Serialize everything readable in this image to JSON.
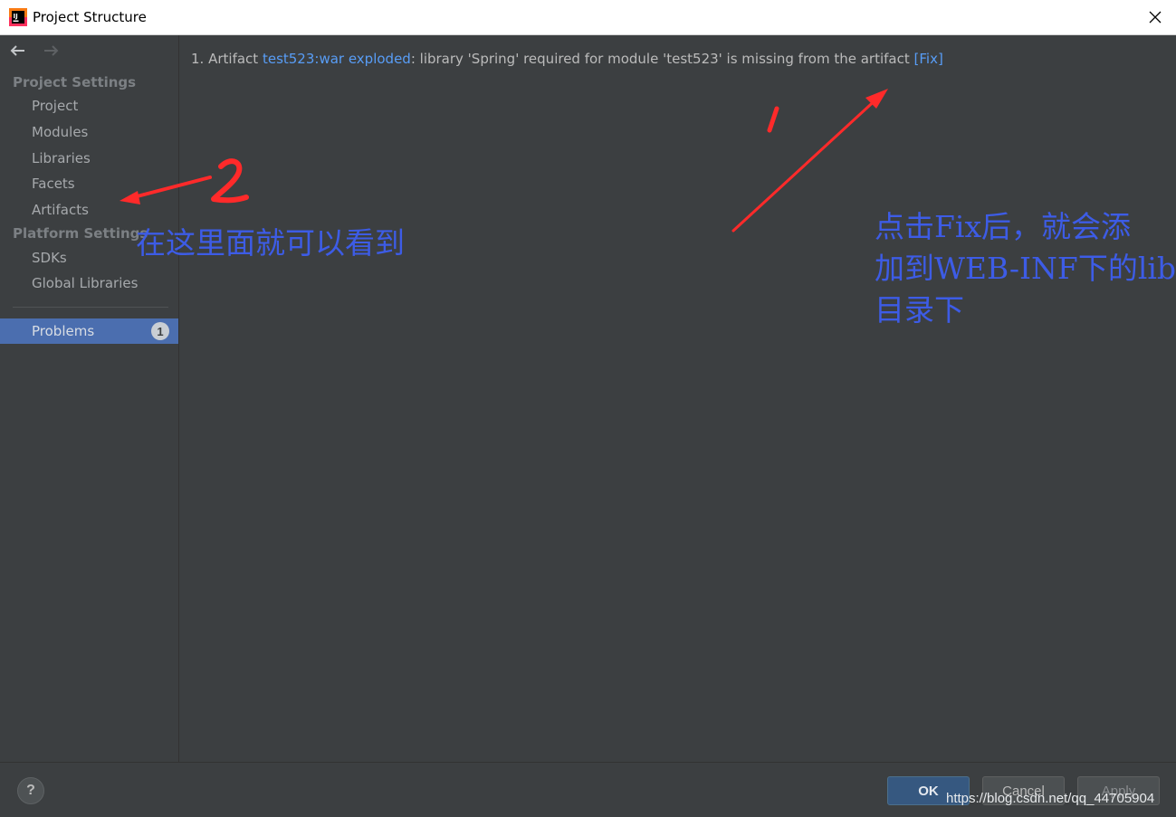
{
  "window": {
    "title": "Project Structure",
    "app_icon": "intellij-idea-icon",
    "close_icon": "close-icon"
  },
  "nav": {
    "back_icon": "arrow-left-icon",
    "forward_icon": "arrow-right-icon"
  },
  "sidebar": {
    "project_settings_header": "Project Settings",
    "project_items": [
      {
        "label": "Project"
      },
      {
        "label": "Modules"
      },
      {
        "label": "Libraries"
      },
      {
        "label": "Facets"
      },
      {
        "label": "Artifacts"
      }
    ],
    "platform_settings_header": "Platform Settings",
    "platform_items": [
      {
        "label": "SDKs"
      },
      {
        "label": "Global Libraries"
      }
    ],
    "problems": {
      "label": "Problems",
      "count": "1"
    }
  },
  "main": {
    "problem": {
      "number": "1.",
      "prefix": "Artifact",
      "artifact_link": "test523:war exploded",
      "message": ": library 'Spring' required for module 'test523' is missing from the artifact",
      "fix_link": "[Fix]"
    }
  },
  "footer": {
    "help_label": "?",
    "ok_label": "OK",
    "cancel_label": "Cancel",
    "apply_label": "Apply"
  },
  "watermark": "https://blog.csdn.net/qq_44705904",
  "annotations": {
    "note_left": "在这里面就可以看到",
    "note_right_lines": [
      "点击Fix后，就会添",
      "加到WEB-INF下的lib",
      "目录下"
    ],
    "marker_1": "1",
    "marker_2": "2",
    "color_text": "#3d5ce6",
    "color_arrow": "#ff2a2a"
  },
  "colors": {
    "background": "#3c3f41",
    "selection": "#4b6eaf",
    "link": "#589df6",
    "text": "#bbbbbb"
  }
}
